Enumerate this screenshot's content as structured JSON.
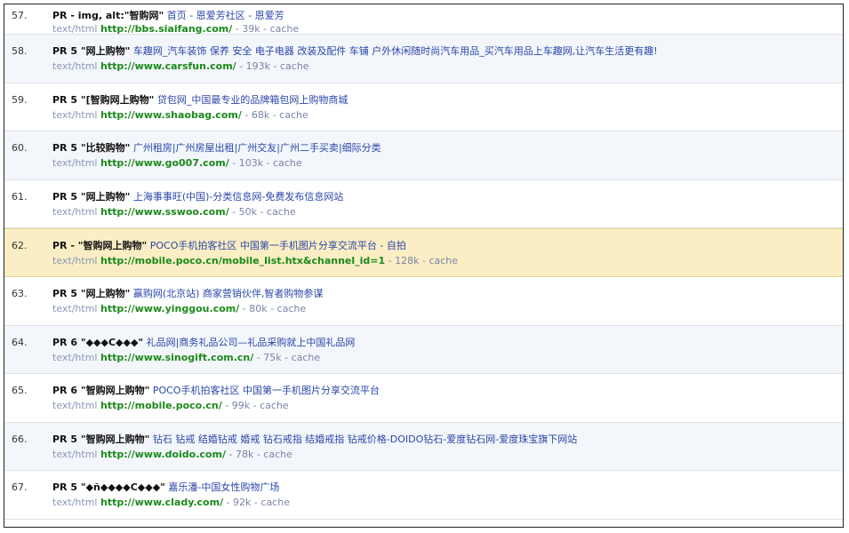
{
  "results": [
    {
      "num": "57.",
      "pr": "PR - ",
      "kw": "img, alt:\"智购网\"",
      "title": "首页 - 恩爱芳社区 - 恩爱芳",
      "mime": "text/html",
      "url": "http://bbs.siaifang.com/",
      "size": " - 39k - ",
      "cache": "cache"
    },
    {
      "num": "58.",
      "pr": "PR 5 ",
      "kw": "\"网上购物\"",
      "title": "车趣网_汽车装饰 保养 安全 电子电器 改装及配件 车铺 户外休闲随时尚汽车用品_买汽车用品上车趣网,让汽车生活更有趣!",
      "mime": "text/html",
      "url": "http://www.carsfun.com/",
      "size": " - 193k - ",
      "cache": "cache"
    },
    {
      "num": "59.",
      "pr": "PR 5 ",
      "kw": "\"[智购网上购物\"",
      "title": "贷包网_中国最专业的品牌箱包网上购物商城",
      "mime": "text/html",
      "url": "http://www.shaobag.com/",
      "size": " - 68k - ",
      "cache": "cache"
    },
    {
      "num": "60.",
      "pr": "PR 5 ",
      "kw": "\"比较购物\"",
      "title": "广州租房|广州房屋出租|广州交友|广州二手买卖|细际分类",
      "mime": "text/html",
      "url": "http://www.go007.com/",
      "size": " - 103k - ",
      "cache": "cache"
    },
    {
      "num": "61.",
      "pr": "PR 5 ",
      "kw": "\"网上购物\"",
      "title": "上海事事旺(中国)-分类信息网-免费发布信息网站",
      "mime": "text/html",
      "url": "http://www.sswoo.com/",
      "size": " - 50k - ",
      "cache": "cache"
    },
    {
      "num": "62.",
      "pr": "PR - ",
      "kw": "\"智购网上购物\"",
      "title": "POCO手机拍客社区 中国第一手机图片分享交流平台 - 自拍",
      "mime": "text/html",
      "url": "http://mobile.poco.cn/mobile_list.htx&channel_id=1",
      "size": " - 128k - ",
      "cache": "cache"
    },
    {
      "num": "63.",
      "pr": "PR 5 ",
      "kw": "\"网上购物\"",
      "title": "赢购网(北京站) 商家营销伙伴,智者购物参谋",
      "mime": "text/html",
      "url": "http://www.yinggou.com/",
      "size": " - 80k - ",
      "cache": "cache"
    },
    {
      "num": "64.",
      "pr": "PR 6 ",
      "kw": "\"◆◆◆C◆◆◆\"",
      "title": "礼品网|商务礼品公司—礼品采购就上中国礼品网",
      "mime": "text/html",
      "url": "http://www.sinogift.com.cn/",
      "size": " - 75k - ",
      "cache": "cache"
    },
    {
      "num": "65.",
      "pr": "PR 6 ",
      "kw": "\"智购网上购物\"",
      "title": "POCO手机拍客社区 中国第一手机图片分享交流平台",
      "mime": "text/html",
      "url": "http://mobile.poco.cn/",
      "size": " - 99k - ",
      "cache": "cache"
    },
    {
      "num": "66.",
      "pr": "PR 5 ",
      "kw": "\"智购网上购物\"",
      "title": "钻石 钻戒 结婚钻戒 婚戒 钻石戒指 结婚戒指 钻戒价格-DOIDO钻石-爱度钻石网-爱度珠宝旗下网站",
      "mime": "text/html",
      "url": "http://www.doido.com/",
      "size": " - 78k - ",
      "cache": "cache"
    },
    {
      "num": "67.",
      "pr": "PR 5 ",
      "kw": "\"◆ñ◆◆◆◆C◆◆◆\"",
      "title": "嘉乐潘-中国女性购物广场",
      "mime": "text/html",
      "url": "http://www.clady.com/",
      "size": " - 92k - ",
      "cache": "cache"
    }
  ]
}
